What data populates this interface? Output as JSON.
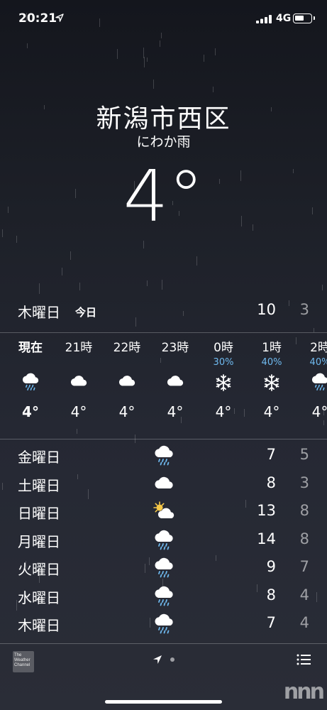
{
  "status_bar": {
    "time": "20:21",
    "network": "4G"
  },
  "location": {
    "city": "新潟市西区",
    "condition": "にわか雨",
    "temperature": "4°"
  },
  "today": {
    "day": "木曜日",
    "badge": "今日",
    "high": "10",
    "low": "3"
  },
  "hourly": [
    {
      "label": "現在",
      "pop": "",
      "icon": "rain-cloud-icon",
      "temp": "4°",
      "now": true
    },
    {
      "label": "21時",
      "pop": "",
      "icon": "cloud-icon",
      "temp": "4°"
    },
    {
      "label": "22時",
      "pop": "",
      "icon": "cloud-icon",
      "temp": "4°"
    },
    {
      "label": "23時",
      "pop": "",
      "icon": "cloud-icon",
      "temp": "4°"
    },
    {
      "label": "0時",
      "pop": "30%",
      "icon": "snowflake-icon",
      "temp": "4°"
    },
    {
      "label": "1時",
      "pop": "40%",
      "icon": "snowflake-icon",
      "temp": "4°"
    },
    {
      "label": "2時",
      "pop": "40%",
      "icon": "rain-cloud-icon",
      "temp": "4°"
    }
  ],
  "daily": [
    {
      "day": "金曜日",
      "icon": "rain-cloud-icon",
      "high": "7",
      "low": "5"
    },
    {
      "day": "土曜日",
      "icon": "cloud-icon",
      "high": "8",
      "low": "3"
    },
    {
      "day": "日曜日",
      "icon": "partly-sunny-icon",
      "high": "13",
      "low": "8"
    },
    {
      "day": "月曜日",
      "icon": "rain-cloud-icon",
      "high": "14",
      "low": "8"
    },
    {
      "day": "火曜日",
      "icon": "rain-cloud-icon",
      "high": "9",
      "low": "7"
    },
    {
      "day": "水曜日",
      "icon": "rain-cloud-icon",
      "high": "8",
      "low": "4"
    },
    {
      "day": "木曜日",
      "icon": "rain-cloud-icon",
      "high": "7",
      "low": "4"
    }
  ],
  "footer": {
    "logo_lines": [
      "The",
      "Weather",
      "Channel"
    ],
    "watermark": "nnn"
  },
  "colors": {
    "precipitation": "#6fbaf0",
    "background_top": "#14161d",
    "background_bottom": "#2a2d37"
  }
}
